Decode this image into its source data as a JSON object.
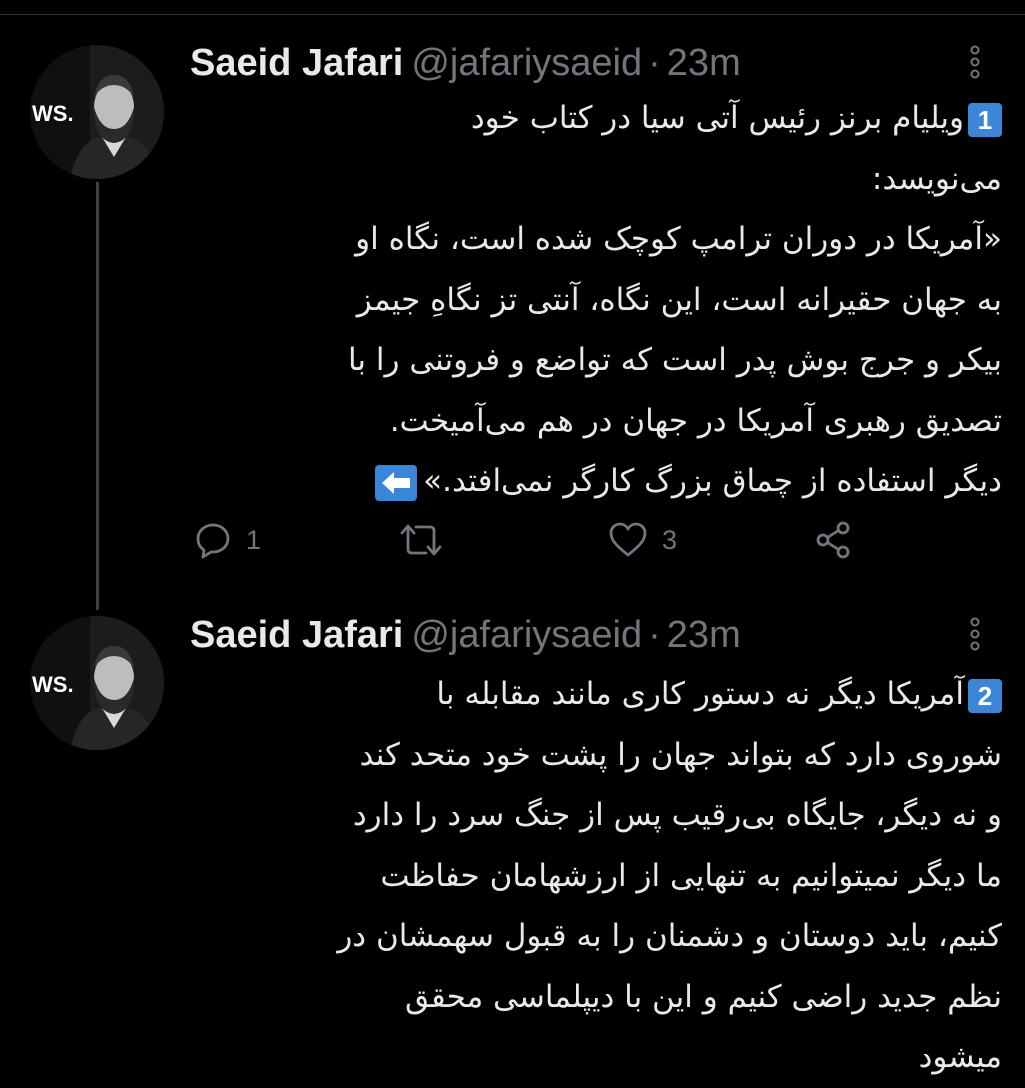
{
  "tweets": [
    {
      "display_name": "Saeid Jafari",
      "handle": "@jafariysaeid",
      "separator": "·",
      "time": "23m",
      "avatar_text": "WS.",
      "thread_number": "1",
      "lines": [
        "ویلیام برنز رئیس آتی سیا در کتاب خود",
        "می‌نویسد:",
        "«آمریکا در دوران ترامپ کوچک شده است، نگاه او",
        "به جهان حقیرانه است، این نگاه، آنتی تز نگاهِ جیمز",
        "بیکر و جرج بوش پدر است که تواضع و فروتنی را با",
        "تصدیق رهبری آمریکا در جهان در هم می‌آمیخت.",
        "دیگر استفاده از چماق بزرگ کارگر نمی‌افتد.»"
      ],
      "actions": {
        "reply_count": "1",
        "retweet_count": "",
        "like_count": "3"
      }
    },
    {
      "display_name": "Saeid Jafari",
      "handle": "@jafariysaeid",
      "separator": "·",
      "time": "23m",
      "avatar_text": "WS.",
      "thread_number": "2",
      "lines": [
        "آمریکا دیگر نه دستور کاری مانند مقابله با",
        "شوروی دارد که بتواند جهان را پشت خود متحد کند",
        "و نه دیگر، جایگاه بی‌رقیب پس از جنگ سرد را دارد",
        "ما دیگر نمیتوانیم به تنهایی از ارزشهامان حفاظت",
        "کنیم، باید دوستان و دشمنان را به قبول سهمشان در",
        "نظم جدید راضی کنیم و این با دیپلماسی محقق",
        "میشود"
      ]
    }
  ],
  "icons": {
    "reply": "comment-icon",
    "retweet": "retweet-icon",
    "like": "heart-icon",
    "share": "share-icon",
    "more": "more-vertical-icon",
    "continue": "left-arrow-emoji-icon"
  },
  "colors": {
    "background": "#000000",
    "text": "#e7e9ea",
    "muted": "#71767b",
    "keycap": "#3b86d6",
    "thread_line": "#3e4144"
  }
}
